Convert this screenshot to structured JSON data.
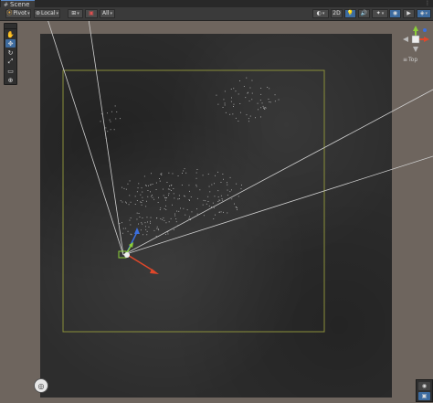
{
  "window": {
    "tab_label": "Scene",
    "tab_icon": "scene-icon"
  },
  "toolbar": {
    "pivot_label": "Pivot",
    "local_label": "Local",
    "grid_snap_icon": "grid-snap-icon",
    "increment_icon": "increment-snap-icon",
    "all_label": "All",
    "right_buttons": [
      "draw-mode-icon",
      "2d-toggle-icon",
      "lighting-icon",
      "audio-icon",
      "effects-icon",
      "scene-visibility-icon",
      "camera-icon",
      "gizmos-icon"
    ]
  },
  "tools_overlay": {
    "items": [
      {
        "name": "hand-tool-icon",
        "glyph": "✋"
      },
      {
        "name": "move-tool-icon",
        "glyph": "✥",
        "active": true
      },
      {
        "name": "rotate-tool-icon",
        "glyph": "↻"
      },
      {
        "name": "scale-tool-icon",
        "glyph": "⤢"
      },
      {
        "name": "rect-tool-icon",
        "glyph": "▭"
      },
      {
        "name": "transform-tool-icon",
        "glyph": "⊕"
      }
    ]
  },
  "orientation": {
    "view_label": "Top",
    "view_icon": "perspective-icon"
  },
  "colors": {
    "terrain": "#2d2d2d",
    "background": "#6e655e",
    "bounds": "#8a8f3a",
    "gizmo_x": "#e0472a",
    "gizmo_y": "#8ccf3a",
    "gizmo_z": "#3b6fe0"
  }
}
